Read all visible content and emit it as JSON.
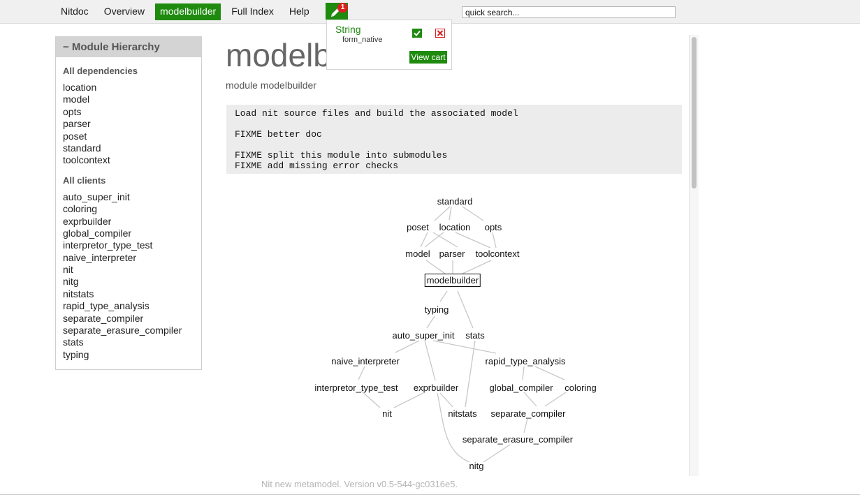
{
  "nav": {
    "items": [
      "Nitdoc",
      "Overview",
      "modelbuilder",
      "Full Index",
      "Help"
    ],
    "active_index": 2,
    "cart_count": "1",
    "cart_icon": "pencil-icon",
    "search_placeholder": "quick search..."
  },
  "cart_popup": {
    "title": "String",
    "item": "form_native",
    "confirm_icon": "check-icon",
    "remove_icon": "close-icon",
    "view_cart_label": "View cart"
  },
  "sidebar": {
    "header": "− Module Hierarchy",
    "dependencies_title": "All dependencies",
    "dependencies": [
      "location",
      "model",
      "opts",
      "parser",
      "poset",
      "standard",
      "toolcontext"
    ],
    "clients_title": "All clients",
    "clients": [
      "auto_super_init",
      "coloring",
      "exprbuilder",
      "global_compiler",
      "interpretor_type_test",
      "naive_interpreter",
      "nit",
      "nitg",
      "nitstats",
      "rapid_type_analysis",
      "separate_compiler",
      "separate_erasure_compiler",
      "stats",
      "typing"
    ]
  },
  "main": {
    "title": "modelbuilder",
    "subtitle": "module modelbuilder",
    "doc": {
      "line1": "Load nit source files and build the associated model",
      "line2": "FIXME better doc",
      "line3": "FIXME split this module into submodules",
      "line4": "FIXME add missing error checks"
    }
  },
  "graph": {
    "current": "modelbuilder",
    "nodes": [
      "standard",
      "poset",
      "location",
      "opts",
      "model",
      "parser",
      "toolcontext",
      "modelbuilder",
      "typing",
      "auto_super_init",
      "stats",
      "naive_interpreter",
      "rapid_type_analysis",
      "interpretor_type_test",
      "exprbuilder",
      "global_compiler",
      "coloring",
      "nit",
      "nitstats",
      "separate_compiler",
      "separate_erasure_compiler",
      "nitg"
    ]
  },
  "footer": "Nit new metamodel. Version v0.5-544-gc0316e5."
}
